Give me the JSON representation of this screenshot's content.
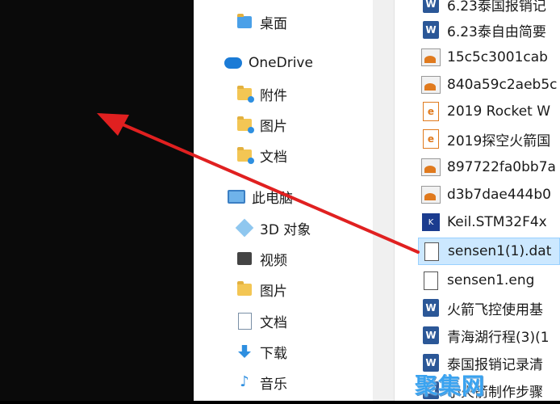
{
  "nav": {
    "desktop": "桌面",
    "onedrive": "OneDrive",
    "attachments": "附件",
    "pictures_od": "图片",
    "documents_od": "文档",
    "this_pc": "此电脑",
    "objects3d": "3D 对象",
    "videos": "视频",
    "pictures": "图片",
    "documents": "文档",
    "downloads": "下载",
    "music": "音乐"
  },
  "files": [
    {
      "name": "6.23泰国报销记",
      "icon": "word-icon"
    },
    {
      "name": "6.23泰自由简要",
      "icon": "word-icon"
    },
    {
      "name": "15c5c3001cab",
      "icon": "image-icon"
    },
    {
      "name": "840a59c2aeb5c",
      "icon": "image-icon"
    },
    {
      "name": "2019 Rocket W",
      "icon": "pdf-icon"
    },
    {
      "name": "2019探空火箭国",
      "icon": "pdf-icon"
    },
    {
      "name": "897722fa0bb7a",
      "icon": "image-icon"
    },
    {
      "name": "d3b7dae444b0",
      "icon": "image-icon"
    },
    {
      "name": "Keil.STM32F4x",
      "icon": "keil-icon"
    },
    {
      "name": "sensen1(1).dat",
      "icon": "file-icon"
    },
    {
      "name": "sensen1.eng",
      "icon": "file-icon"
    },
    {
      "name": "火箭飞控使用基",
      "icon": "word-icon"
    },
    {
      "name": "青海湖行程(3)(1",
      "icon": "word-icon"
    },
    {
      "name": "泰国报销记录清",
      "icon": "word-icon"
    },
    {
      "name": "小火箭制作步骤",
      "icon": "word-icon"
    }
  ],
  "watermark": "聚集网",
  "colors": {
    "arrow": "#e02020",
    "selection": "#cce8ff",
    "folder": "#f3c654"
  }
}
